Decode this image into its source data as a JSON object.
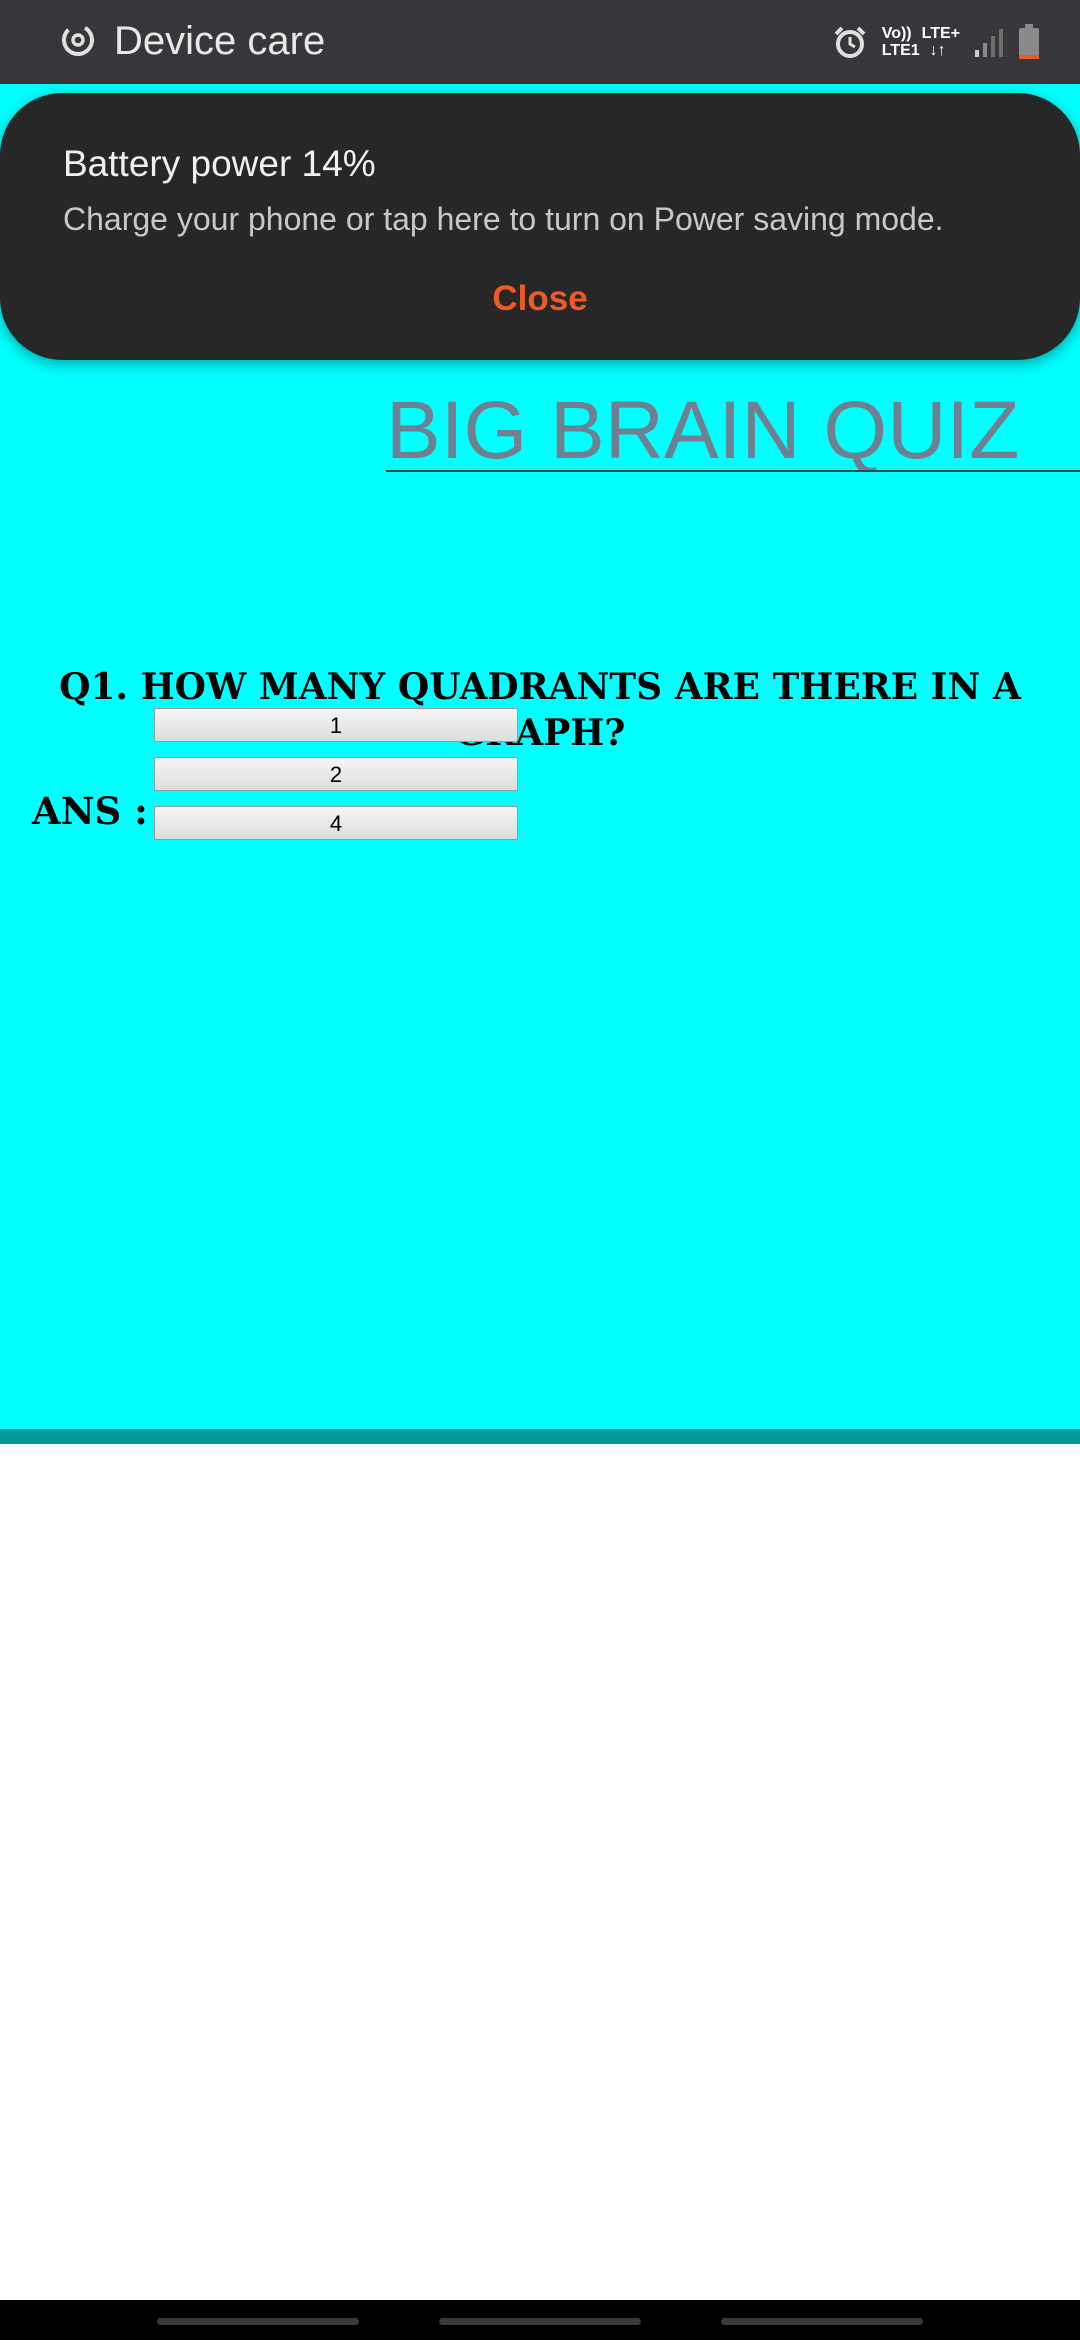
{
  "status_bar": {
    "app_name": "Device care",
    "network": {
      "row1_left": "Vo))",
      "row1_right": "LTE+",
      "row2_left": "LTE1",
      "row2_right": "↓↑"
    },
    "battery_level": 0.14,
    "battery_color": "#e65a2e"
  },
  "notification": {
    "title": "Battery power 14%",
    "body": "Charge your phone or tap here to turn on Power saving mode.",
    "close_label": "Close",
    "close_color": "#f05a28"
  },
  "page": {
    "background": "#00ffff",
    "title": "BIG BRAIN QUIZ",
    "question": "Q1. HOW MANY QUADRANTS ARE THERE IN A GRAPH?",
    "answer_label": "ANS :",
    "options": [
      "1",
      "2",
      "4"
    ]
  }
}
